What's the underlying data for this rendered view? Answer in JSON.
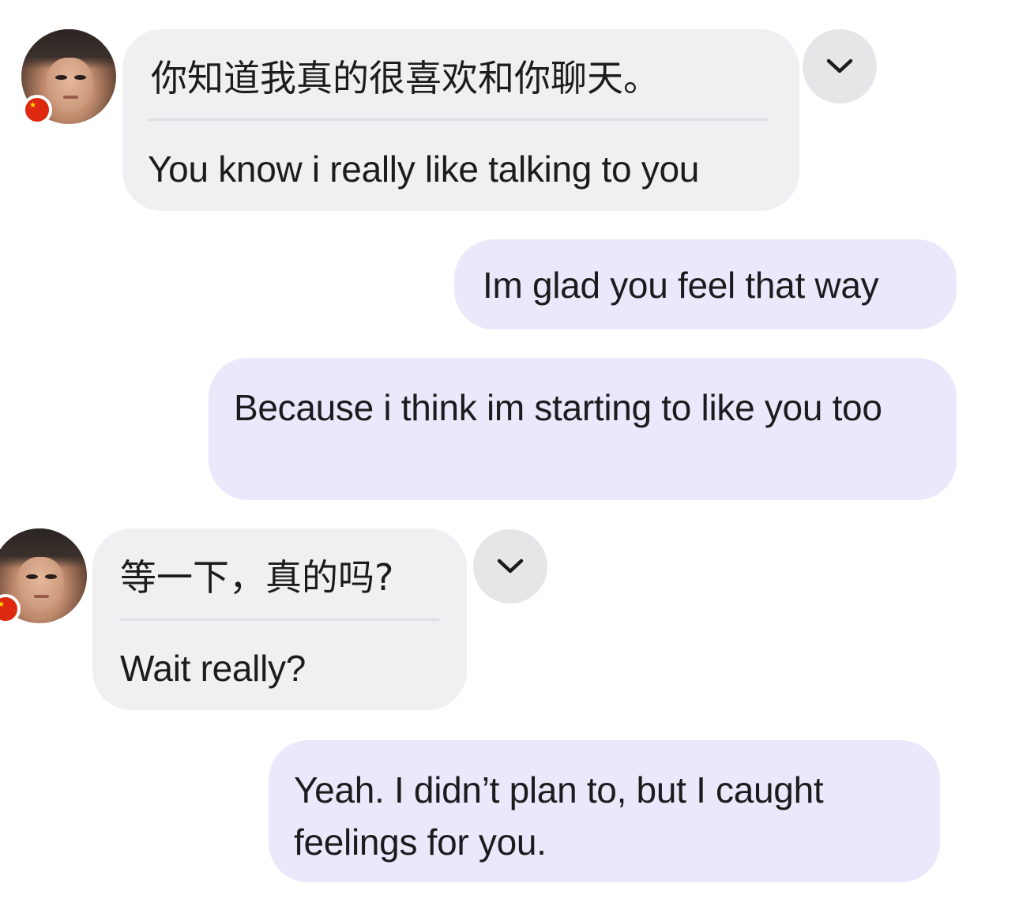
{
  "messages": [
    {
      "direction": "incoming",
      "original": "你知道我真的很喜欢和你聊天。",
      "translation": "You know i really like talking to you"
    },
    {
      "direction": "outgoing",
      "text": "Im glad you feel that way"
    },
    {
      "direction": "outgoing",
      "text": "Because i think im starting to like you too"
    },
    {
      "direction": "incoming",
      "original": "等一下，真的吗?",
      "translation": "Wait really?"
    },
    {
      "direction": "outgoing",
      "text": "Yeah. I didn’t plan to, but I caught feelings for you."
    }
  ],
  "icons": {
    "translate_toggle": "chevron-down-icon",
    "sender_flag": "china-flag-icon"
  },
  "colors": {
    "incoming_bubble": "#f0f0f2",
    "outgoing_bubble": "#ebe8fb",
    "chevron_button": "#e6e6e8"
  }
}
